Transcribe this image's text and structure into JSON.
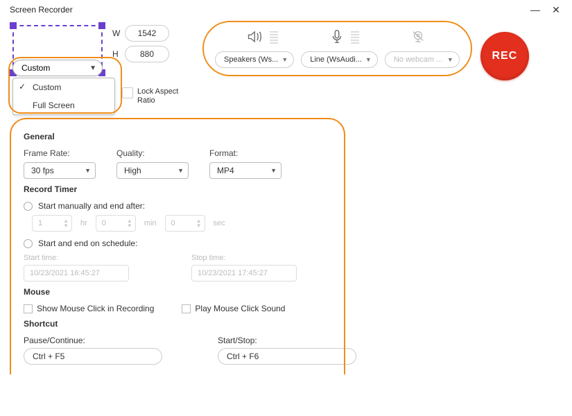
{
  "window": {
    "title": "Screen Recorder"
  },
  "capture": {
    "width_label": "W",
    "width_value": "1542",
    "height_label": "H",
    "height_value": "880",
    "size_mode": "Custom",
    "size_options": [
      "Custom",
      "Full Screen"
    ],
    "lock_label": "Lock Aspect Ratio"
  },
  "audio": {
    "speaker_select": "Speakers (Ws...",
    "mic_select": "Line (WsAudi...",
    "webcam_select": "No webcam ..."
  },
  "rec_button": "REC",
  "general": {
    "title": "General",
    "frame_rate_label": "Frame Rate:",
    "frame_rate_value": "30 fps",
    "quality_label": "Quality:",
    "quality_value": "High",
    "format_label": "Format:",
    "format_value": "MP4"
  },
  "timer": {
    "title": "Record Timer",
    "manual_label": "Start manually and end after:",
    "hr_value": "1",
    "hr_unit": "hr",
    "min_value": "0",
    "min_unit": "min",
    "sec_value": "0",
    "sec_unit": "sec",
    "schedule_label": "Start and end on schedule:",
    "start_label": "Start time:",
    "start_value": "10/23/2021 16:45:27",
    "stop_label": "Stop time:",
    "stop_value": "10/23/2021 17:45:27"
  },
  "mouse": {
    "title": "Mouse",
    "show_click_label": "Show Mouse Click in Recording",
    "play_sound_label": "Play Mouse Click Sound"
  },
  "shortcut": {
    "title": "Shortcut",
    "pause_label": "Pause/Continue:",
    "pause_value": "Ctrl + F5",
    "start_label": "Start/Stop:",
    "start_value": "Ctrl + F6"
  }
}
